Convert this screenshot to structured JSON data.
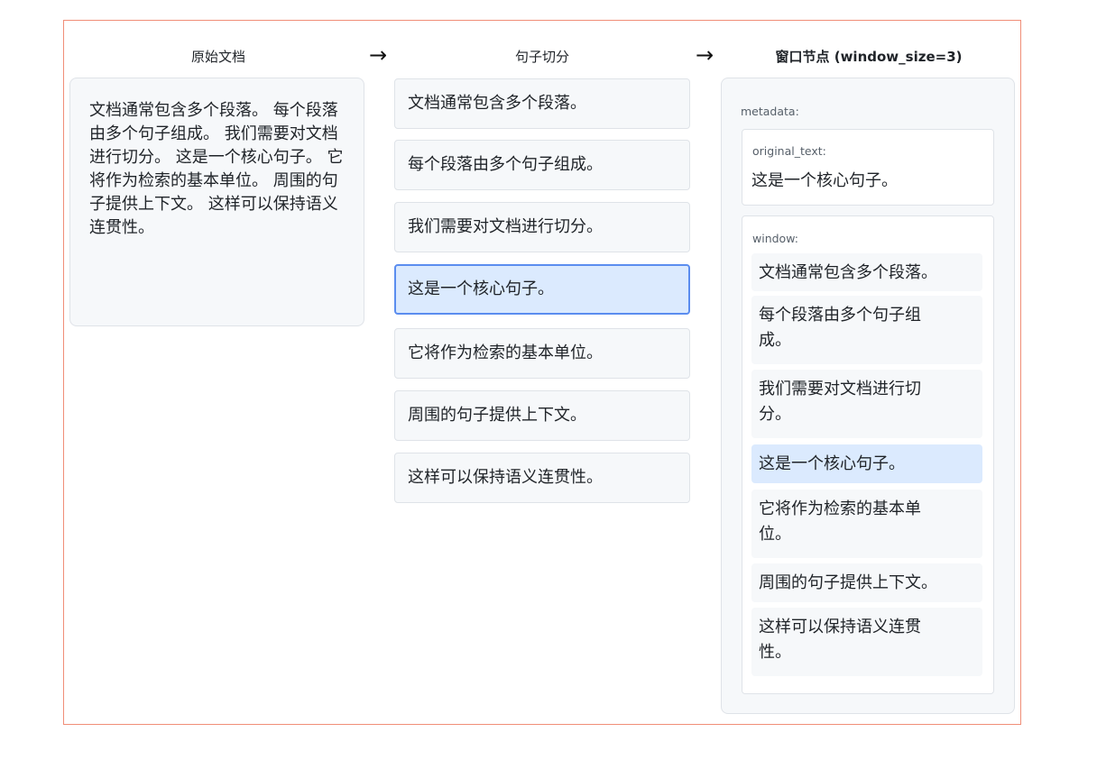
{
  "columns": {
    "original": {
      "title": "原始文档"
    },
    "split": {
      "title": "句子切分"
    },
    "window": {
      "title": "窗口节点 (window_size=3)"
    }
  },
  "arrows": [
    "→",
    "→"
  ],
  "original_document": "文档通常包含多个段落。 每个段落由多个句子组成。 我们需要对文档进行切分。 这是一个核心句子。 它将作为检索的基本单位。 周围的句子提供上下文。 这样可以保持语义连贯性。",
  "sentences": [
    {
      "text": "文档通常包含多个段落。",
      "highlighted": false
    },
    {
      "text": "每个段落由多个句子组成。",
      "highlighted": false
    },
    {
      "text": "我们需要对文档进行切分。",
      "highlighted": false
    },
    {
      "text": "这是一个核心句子。",
      "highlighted": true
    },
    {
      "text": "它将作为检索的基本单位。",
      "highlighted": false
    },
    {
      "text": "周围的句子提供上下文。",
      "highlighted": false
    },
    {
      "text": "这样可以保持语义连贯性。",
      "highlighted": false
    }
  ],
  "window_node": {
    "metadata_label": "metadata:",
    "original_text_label": "original_text:",
    "original_text_value": "这是一个核心句子。",
    "window_label": "window:",
    "window_lines": [
      {
        "lines": [
          "文档通常包含多个段落。"
        ],
        "highlighted": false
      },
      {
        "lines": [
          "每个段落由多个句子组",
          "成。"
        ],
        "highlighted": false
      },
      {
        "lines": [
          "我们需要对文档进行切",
          "分。"
        ],
        "highlighted": false
      },
      {
        "lines": [
          "这是一个核心句子。"
        ],
        "highlighted": true
      },
      {
        "lines": [
          "它将作为检索的基本单",
          "位。"
        ],
        "highlighted": false
      },
      {
        "lines": [
          "周围的句子提供上下文。"
        ],
        "highlighted": false
      },
      {
        "lines": [
          "这样可以保持语义连贯",
          "性。"
        ],
        "highlighted": false
      }
    ]
  },
  "colors": {
    "frame_border": "#f08e78",
    "highlight_fill": "#dbeafe",
    "highlight_border": "#5b8def",
    "card_fill": "#f6f8fa"
  }
}
